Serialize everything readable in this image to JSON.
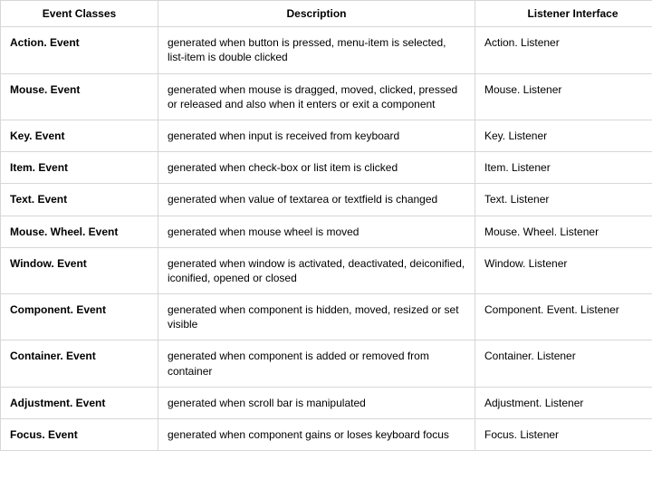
{
  "headers": {
    "c1": "Event Classes",
    "c2": "Description",
    "c3": "Listener Interface"
  },
  "rows": [
    {
      "event": "Action. Event",
      "desc": "generated when button is pressed, menu-item is selected, list-item is double clicked",
      "listener": "Action. Listener"
    },
    {
      "event": "Mouse. Event",
      "desc": "generated when mouse is dragged, moved, clicked, pressed or released and also when it enters or exit a component",
      "listener": "Mouse. Listener"
    },
    {
      "event": "Key. Event",
      "desc": "generated when input is received from keyboard",
      "listener": "Key. Listener"
    },
    {
      "event": "Item. Event",
      "desc": "generated when check-box or list item is clicked",
      "listener": "Item. Listener"
    },
    {
      "event": "Text. Event",
      "desc": "generated when value of textarea or textfield is changed",
      "listener": "Text. Listener"
    },
    {
      "event": "Mouse. Wheel. Event",
      "desc": "generated when mouse wheel is moved",
      "listener": "Mouse. Wheel. Listener"
    },
    {
      "event": "Window. Event",
      "desc": "generated when window is activated, deactivated, deiconified, iconified, opened or closed",
      "listener": "Window. Listener"
    },
    {
      "event": "Component. Event",
      "desc": "generated when component is hidden, moved, resized or set visible",
      "listener": "Component. Event. Listener"
    },
    {
      "event": "Container. Event",
      "desc": "generated when component is added or removed from container",
      "listener": "Container. Listener"
    },
    {
      "event": "Adjustment. Event",
      "desc": "generated when scroll bar is manipulated",
      "listener": "Adjustment. Listener"
    },
    {
      "event": "Focus. Event",
      "desc": "generated when component gains or loses keyboard focus",
      "listener": "Focus. Listener"
    }
  ]
}
